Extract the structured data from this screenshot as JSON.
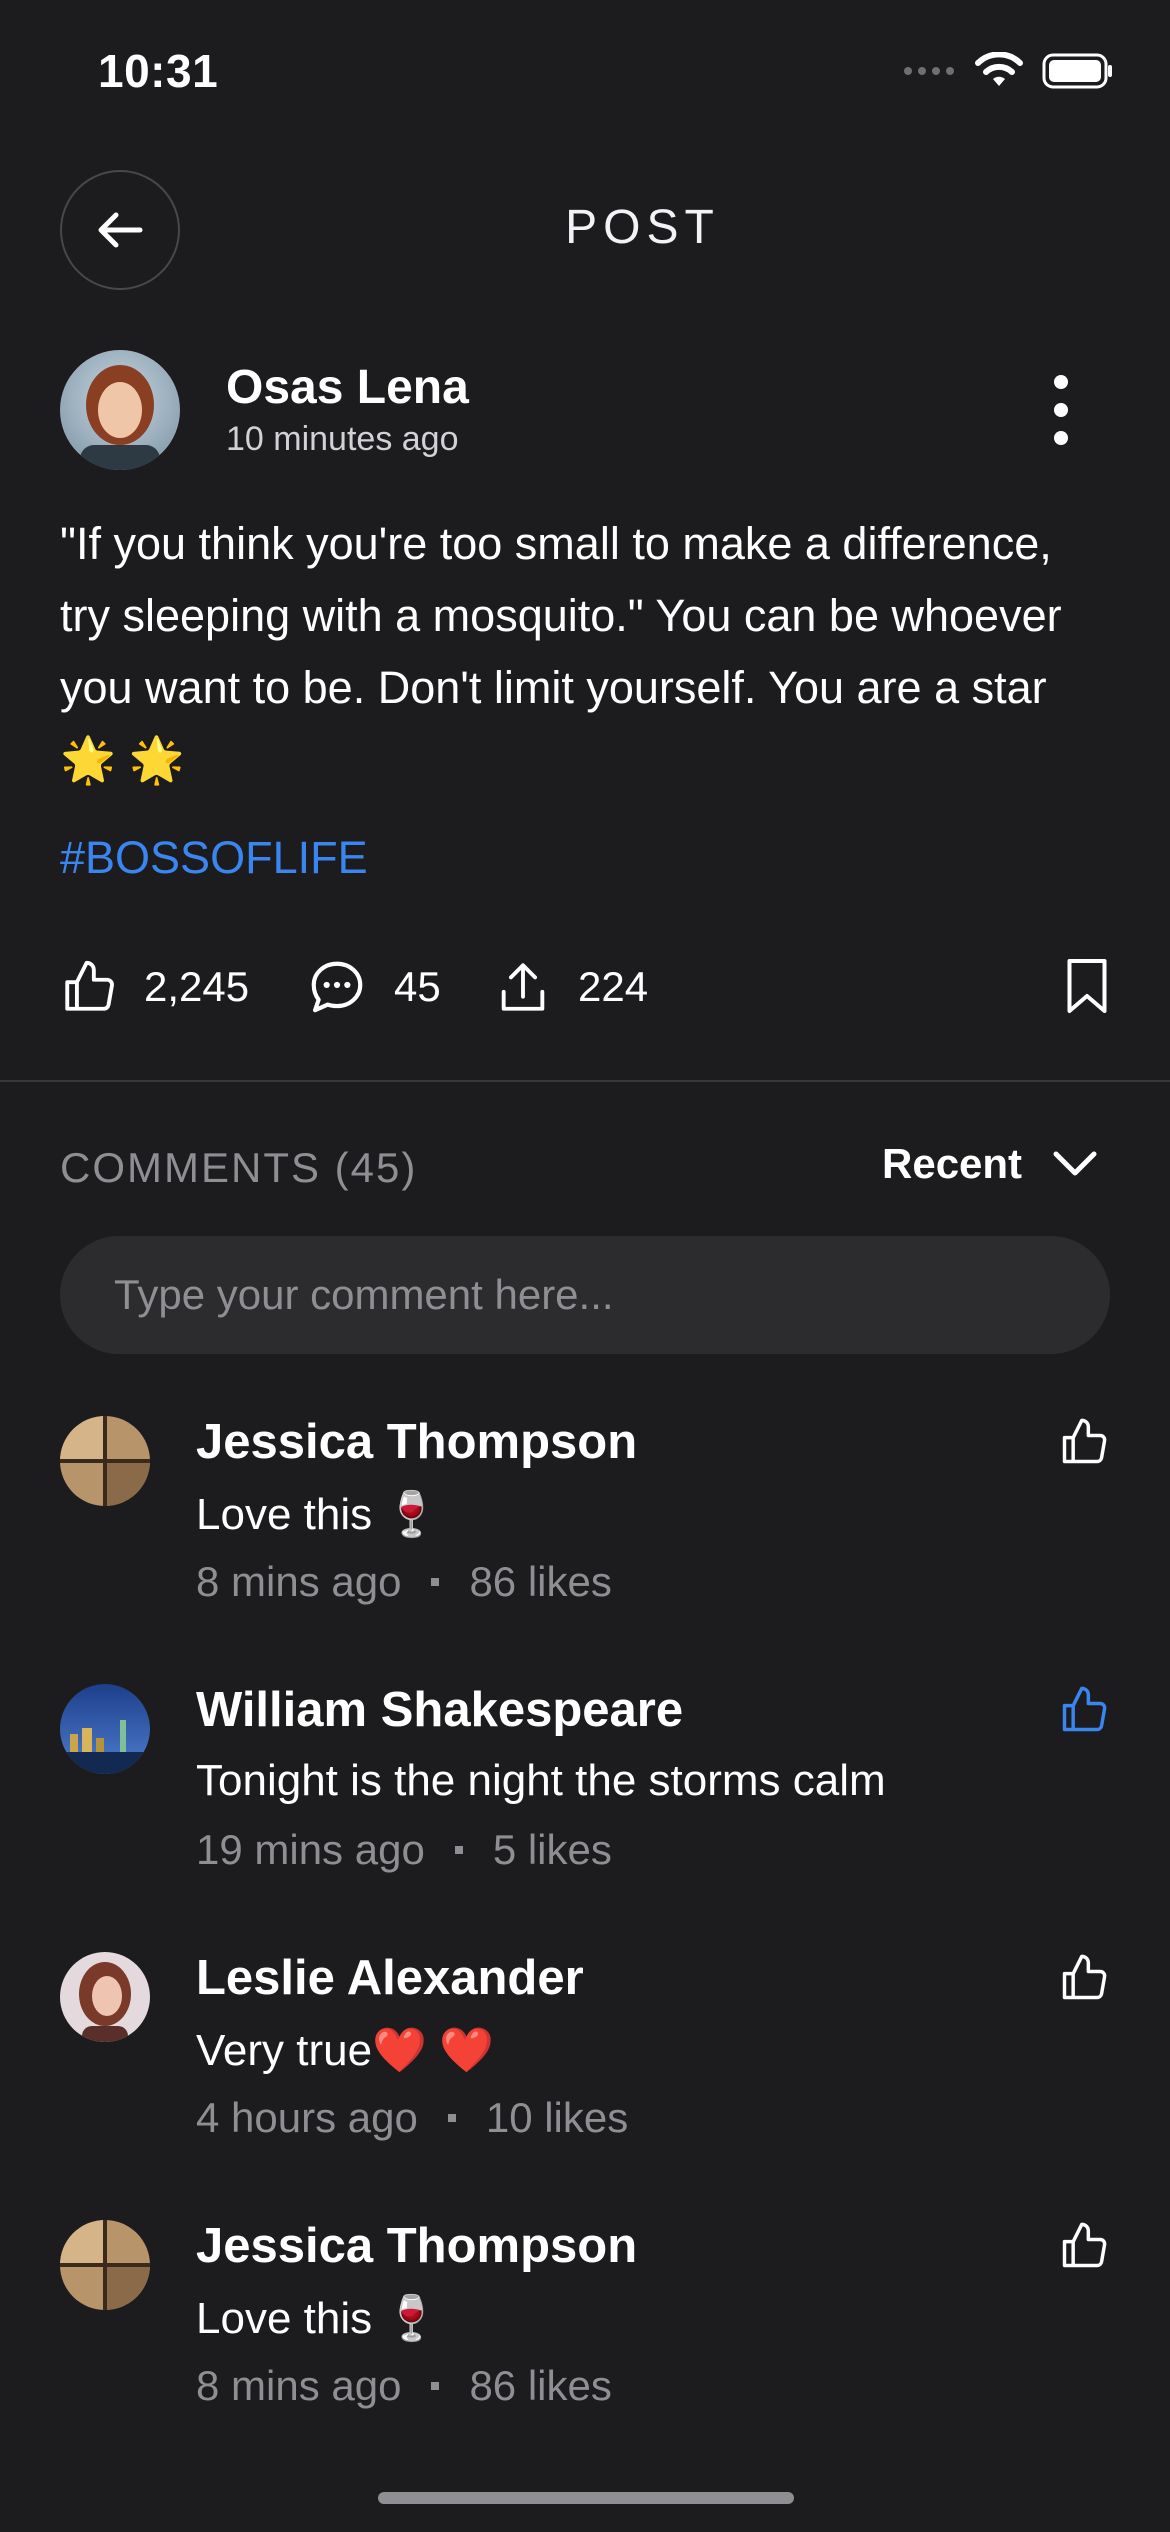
{
  "status_bar": {
    "time": "10:31"
  },
  "header": {
    "title": "POST"
  },
  "post": {
    "author": "Osas Lena",
    "time": "10 minutes ago",
    "text": "\"If you think you're too small to make a difference, try sleeping with a mosquito.\" You can be whoever you want to be. Don't limit yourself. You are a star 🌟 🌟",
    "hashtag": "#BOSSOFLIFE",
    "likes": "2,245",
    "comments": "45",
    "shares": "224"
  },
  "comments_section": {
    "title": "COMMENTS (45)",
    "sort": "Recent",
    "input_placeholder": "Type your comment here..."
  },
  "comments": [
    {
      "name": "Jessica Thompson",
      "text": "Love this 🍷",
      "time": "8 mins ago",
      "likes": "86 likes",
      "liked": false
    },
    {
      "name": "William Shakespeare",
      "text": "Tonight is the night the storms calm",
      "time": "19 mins ago",
      "likes": "5 likes",
      "liked": true
    },
    {
      "name": "Leslie Alexander",
      "text": "Very true❤️ ❤️",
      "time": "4 hours ago",
      "likes": "10 likes",
      "liked": false
    },
    {
      "name": "Jessica Thompson",
      "text": "Love this 🍷",
      "time": "8 mins ago",
      "likes": "86 likes",
      "liked": false
    }
  ],
  "colors": {
    "background": "#1c1c1e",
    "accent": "#3a86f0",
    "muted": "#8e8e93",
    "input_bg": "#2c2c2e"
  },
  "icons": [
    "back-arrow-icon",
    "more-vertical-icon",
    "thumbs-up-icon",
    "comment-bubble-icon",
    "share-icon",
    "bookmark-icon",
    "chevron-down-icon",
    "wifi-icon",
    "battery-icon"
  ]
}
